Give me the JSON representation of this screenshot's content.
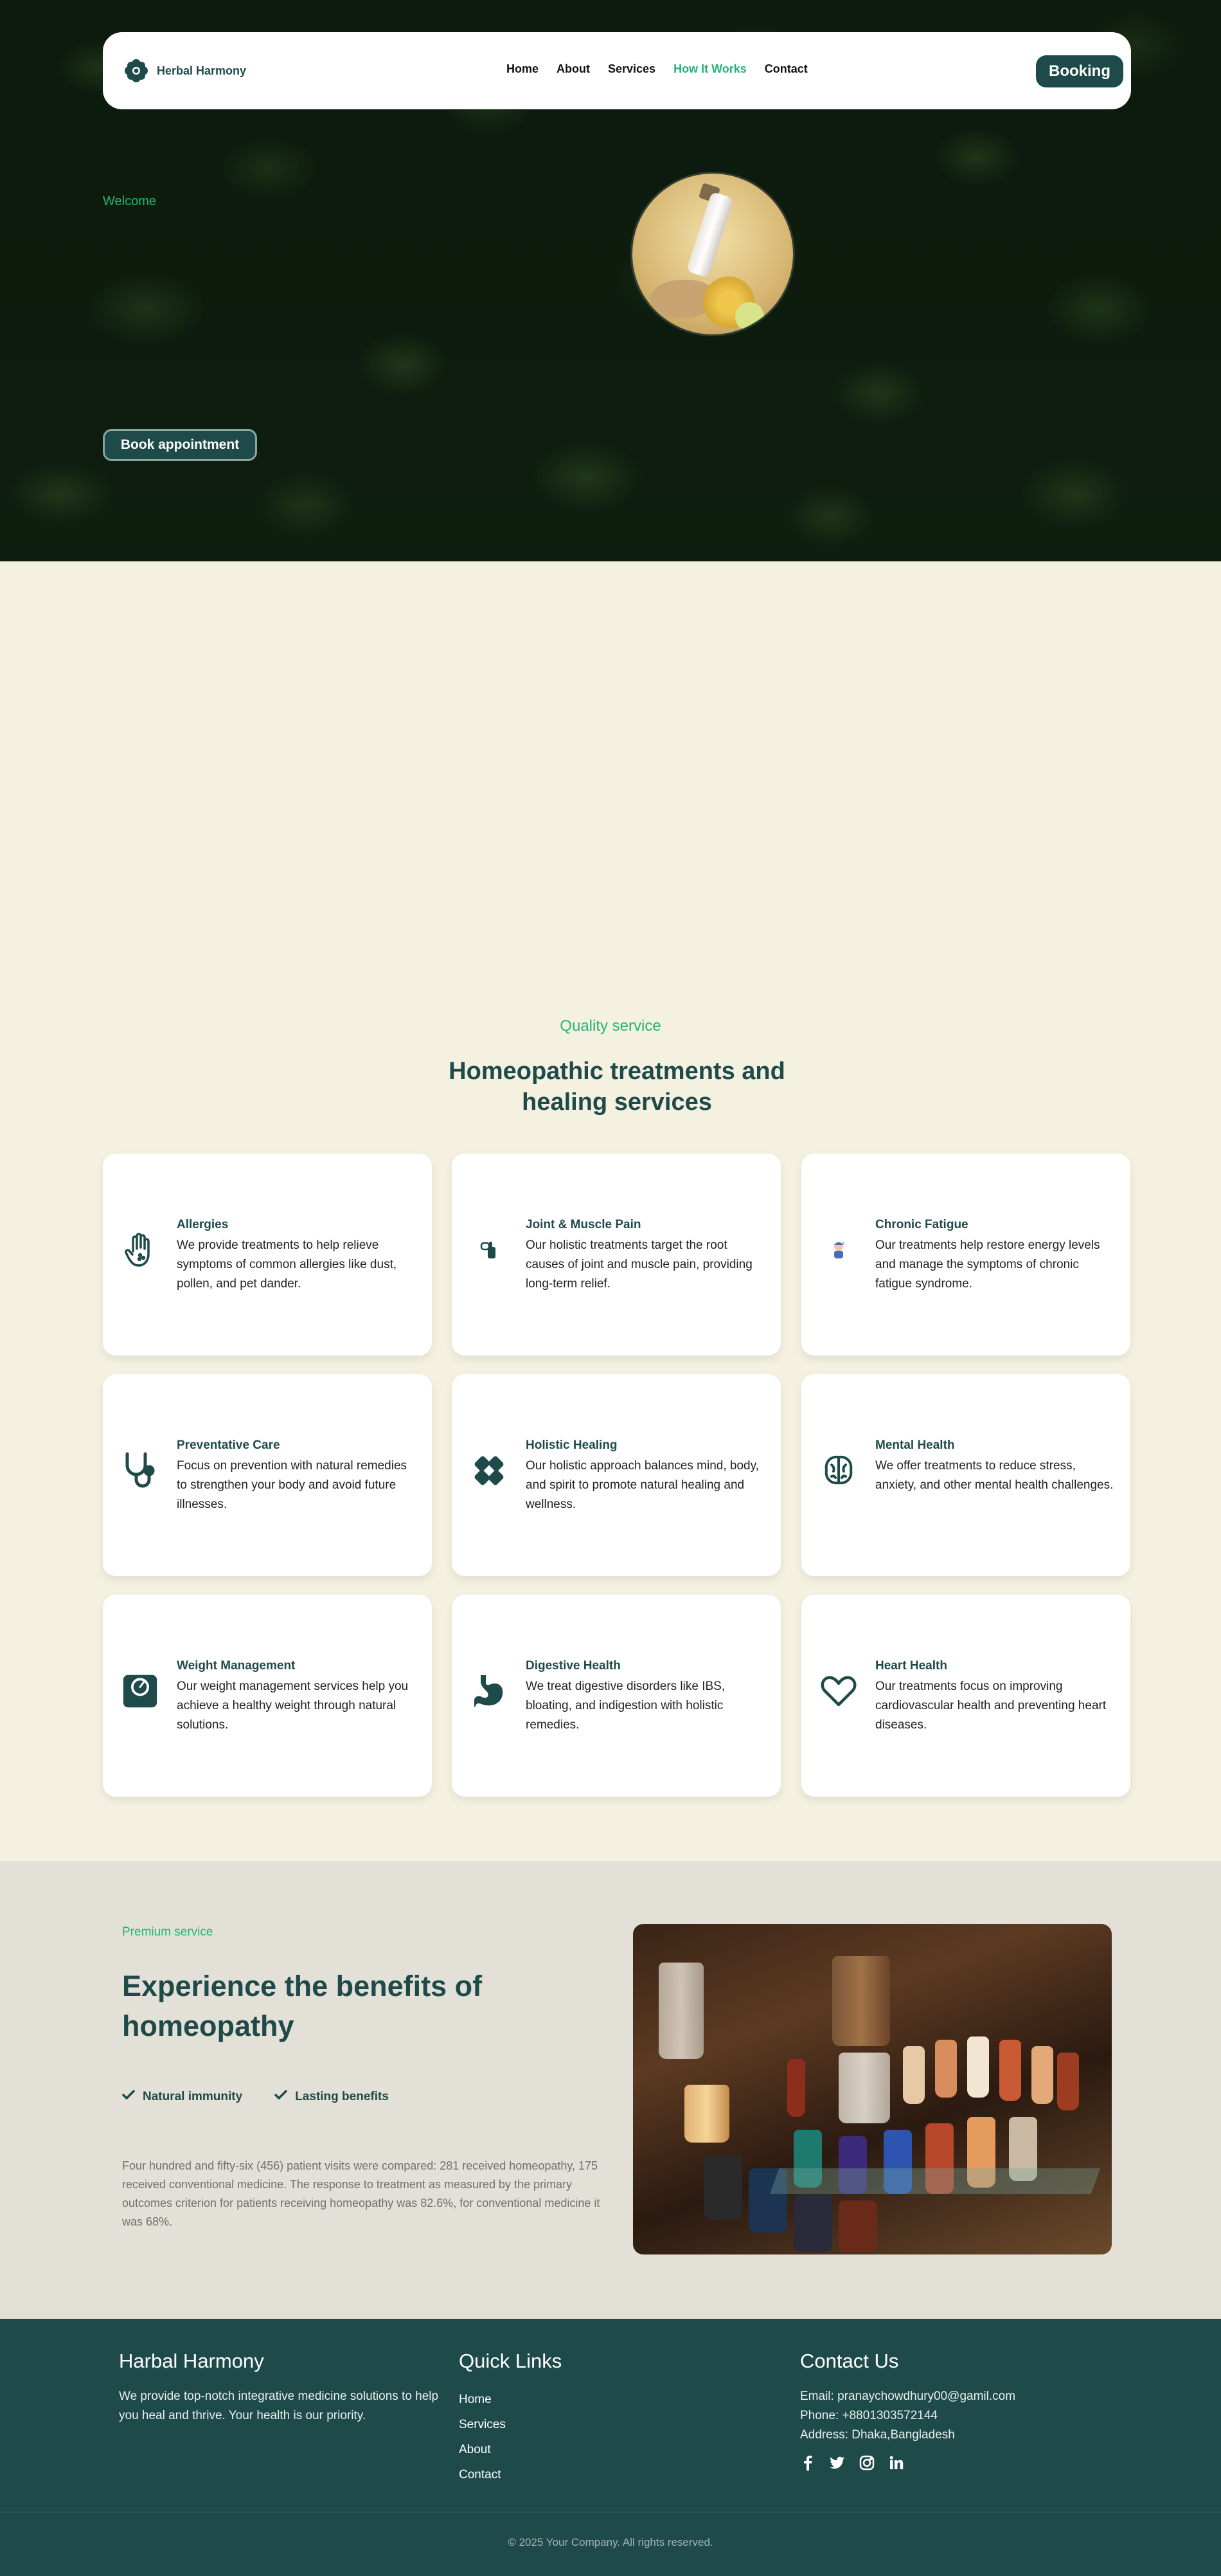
{
  "brand": {
    "name": "Herbal Harmony"
  },
  "nav": {
    "links": [
      "Home",
      "About",
      "Services",
      "How It Works",
      "Contact"
    ],
    "active_index": 3,
    "booking_label": "Booking"
  },
  "hero": {
    "welcome": "Welcome",
    "cta_label": "Book appointment"
  },
  "services": {
    "label": "Quality service",
    "title": "Homeopathic treatments and healing services",
    "cards": [
      {
        "icon": "hand-icon",
        "title": "Allergies",
        "desc": "We provide treatments to help relieve symptoms of common allergies like dust, pollen, and pet dander."
      },
      {
        "icon": "joint-icon",
        "title": "Joint & Muscle Pain",
        "desc": "Our holistic treatments target the root causes of joint and muscle pain, providing long-term relief."
      },
      {
        "icon": "tired-person-icon",
        "title": "Chronic Fatigue",
        "desc": "Our treatments help restore energy levels and manage the symptoms of chronic fatigue syndrome."
      },
      {
        "icon": "stethoscope-icon",
        "title": "Preventative Care",
        "desc": "Focus on prevention with natural remedies to strengthen your body and avoid future illnesses."
      },
      {
        "icon": "bandage-icon",
        "title": "Holistic Healing",
        "desc": "Our holistic approach balances mind, body, and spirit to promote natural healing and wellness."
      },
      {
        "icon": "brain-icon",
        "title": "Mental Health",
        "desc": "We offer treatments to reduce stress, anxiety, and other mental health challenges."
      },
      {
        "icon": "weight-scale-icon",
        "title": "Weight Management",
        "desc": "Our weight management services help you achieve a healthy weight through natural solutions."
      },
      {
        "icon": "stomach-icon",
        "title": "Digestive Health",
        "desc": "We treat digestive disorders like IBS, bloating, and indigestion with holistic remedies."
      },
      {
        "icon": "heart-icon",
        "title": "Heart Health",
        "desc": "Our treatments focus on improving cardiovascular health and preventing heart diseases."
      }
    ]
  },
  "benefits": {
    "label": "Premium service",
    "title": "Experience the benefits of homeopathy",
    "checks": [
      "Natural immunity",
      "Lasting benefits"
    ],
    "text": "Four hundred and fifty-six (456) patient visits were compared: 281 received homeopathy, 175 received conventional medicine. The response to treatment as measured by the primary outcomes criterion for patients receiving homeopathy was 82.6%, for conventional medicine it was 68%."
  },
  "footer": {
    "about_title": "Harbal Harmony",
    "about_text": "We provide top-notch integrative medicine solutions to help you heal and thrive. Your health is our priority.",
    "links_title": "Quick Links",
    "links": [
      "Home",
      "Services",
      "About",
      "Contact"
    ],
    "contact_title": "Contact Us",
    "email": "Email: pranaychowdhury00@gamil.com",
    "phone": "Phone: +8801303572144",
    "address": "Address: Dhaka,Bangladesh",
    "socials": [
      "facebook-icon",
      "twitter-icon",
      "instagram-icon",
      "linkedin-icon"
    ],
    "copyright": "© 2025 Your Company. All rights reserved."
  },
  "colors": {
    "primary": "#1f4a4a",
    "accent": "#22b573",
    "cream": "#f5f1e1",
    "benefits_bg": "#e3e0d7"
  }
}
